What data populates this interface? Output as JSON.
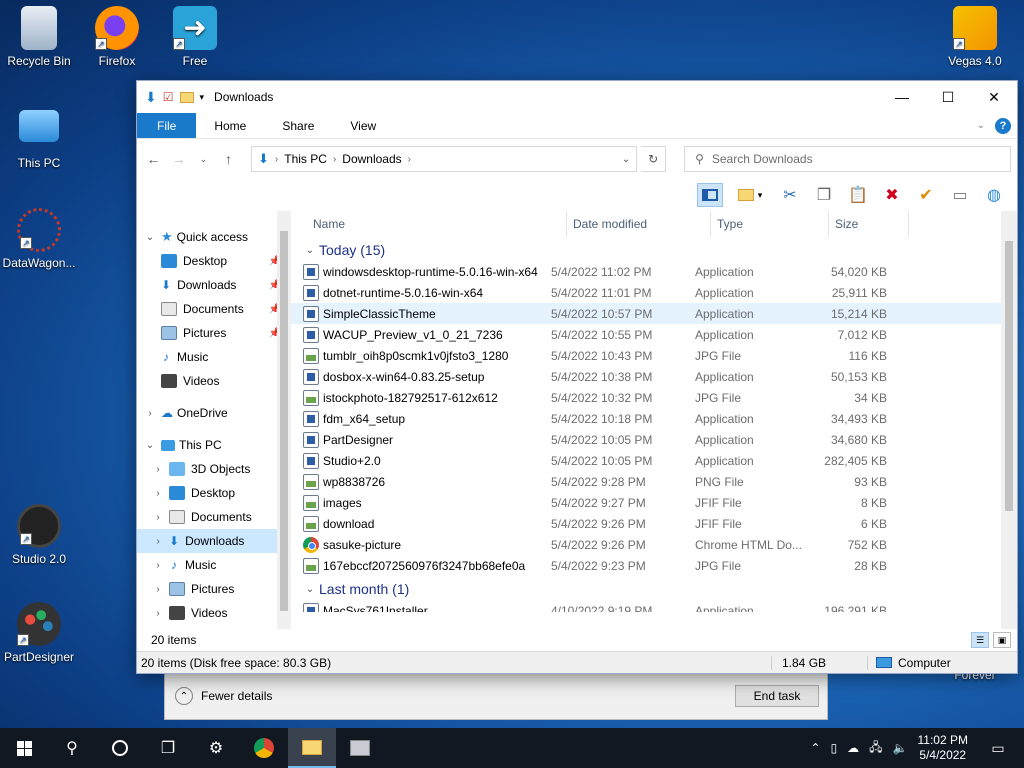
{
  "desktop": {
    "icons_left": [
      {
        "label": "Recycle Bin",
        "icon": "recycle-bin-icon"
      },
      {
        "label": "This PC",
        "icon": "computer-icon"
      },
      {
        "label": "DataWagon...",
        "icon": "datawagon-icon"
      },
      {
        "label": "Studio 2.0",
        "icon": "studio-icon"
      },
      {
        "label": "PartDesigner",
        "icon": "palette-icon"
      }
    ],
    "icons_top": [
      {
        "label": "Firefox",
        "icon": "firefox-icon"
      },
      {
        "label": "Free Downlo...",
        "icon": "fdm-icon"
      }
    ],
    "icon_right": {
      "label": "Vegas 4.0",
      "icon": "vegas-icon"
    },
    "partial_label": "Forever"
  },
  "taskmgr": {
    "fewer_details": "Fewer details",
    "end_task": "End task"
  },
  "window": {
    "title": "Downloads",
    "tabs": [
      "File",
      "Home",
      "Share",
      "View"
    ],
    "address": {
      "crumbs": [
        "This PC",
        "Downloads"
      ]
    },
    "search_placeholder": "Search Downloads",
    "columns": {
      "name": "Name",
      "date": "Date modified",
      "type": "Type",
      "size": "Size"
    },
    "nav": {
      "quick_access": "Quick access",
      "qa_items": [
        "Desktop",
        "Downloads",
        "Documents",
        "Pictures",
        "Music",
        "Videos"
      ],
      "onedrive": "OneDrive",
      "this_pc": "This PC",
      "pc_items": [
        "3D Objects",
        "Desktop",
        "Documents",
        "Downloads",
        "Music",
        "Pictures",
        "Videos"
      ]
    },
    "groups": {
      "today": "Today (15)",
      "last_month": "Last month (1)"
    },
    "files_today": [
      {
        "name": "windowsdesktop-runtime-5.0.16-win-x64",
        "date": "5/4/2022 11:02 PM",
        "type": "Application",
        "size": "54,020 KB",
        "kind": "app"
      },
      {
        "name": "dotnet-runtime-5.0.16-win-x64",
        "date": "5/4/2022 11:01 PM",
        "type": "Application",
        "size": "25,911 KB",
        "kind": "app"
      },
      {
        "name": "SimpleClassicTheme",
        "date": "5/4/2022 10:57 PM",
        "type": "Application",
        "size": "15,214 KB",
        "kind": "app"
      },
      {
        "name": "WACUP_Preview_v1_0_21_7236",
        "date": "5/4/2022 10:55 PM",
        "type": "Application",
        "size": "7,012 KB",
        "kind": "app"
      },
      {
        "name": "tumblr_oih8p0scmk1v0jfsto3_1280",
        "date": "5/4/2022 10:43 PM",
        "type": "JPG File",
        "size": "116 KB",
        "kind": "img"
      },
      {
        "name": "dosbox-x-win64-0.83.25-setup",
        "date": "5/4/2022 10:38 PM",
        "type": "Application",
        "size": "50,153 KB",
        "kind": "app"
      },
      {
        "name": "istockphoto-182792517-612x612",
        "date": "5/4/2022 10:32 PM",
        "type": "JPG File",
        "size": "34 KB",
        "kind": "img"
      },
      {
        "name": "fdm_x64_setup",
        "date": "5/4/2022 10:18 PM",
        "type": "Application",
        "size": "34,493 KB",
        "kind": "app"
      },
      {
        "name": "PartDesigner",
        "date": "5/4/2022 10:05 PM",
        "type": "Application",
        "size": "34,680 KB",
        "kind": "app"
      },
      {
        "name": "Studio+2.0",
        "date": "5/4/2022 10:05 PM",
        "type": "Application",
        "size": "282,405 KB",
        "kind": "app"
      },
      {
        "name": "wp8838726",
        "date": "5/4/2022 9:28 PM",
        "type": "PNG File",
        "size": "93 KB",
        "kind": "img"
      },
      {
        "name": "images",
        "date": "5/4/2022 9:27 PM",
        "type": "JFIF File",
        "size": "8 KB",
        "kind": "img"
      },
      {
        "name": "download",
        "date": "5/4/2022 9:26 PM",
        "type": "JFIF File",
        "size": "6 KB",
        "kind": "img"
      },
      {
        "name": "sasuke-picture",
        "date": "5/4/2022 9:26 PM",
        "type": "Chrome HTML Do...",
        "size": "752 KB",
        "kind": "chrome"
      },
      {
        "name": "167ebccf2072560976f3247bb68efe0a",
        "date": "5/4/2022 9:23 PM",
        "type": "JPG File",
        "size": "28 KB",
        "kind": "img"
      }
    ],
    "files_last_month": [
      {
        "name": "MacSys761Installer",
        "date": "4/10/2022 9:19 PM",
        "type": "Application",
        "size": "196,291 KB",
        "kind": "app"
      }
    ],
    "items_count": "20 items",
    "status": {
      "left": "20 items (Disk free space: 80.3 GB)",
      "size": "1.84 GB",
      "location": "Computer"
    }
  },
  "taskbar": {
    "time": "11:02 PM",
    "date": "5/4/2022"
  }
}
